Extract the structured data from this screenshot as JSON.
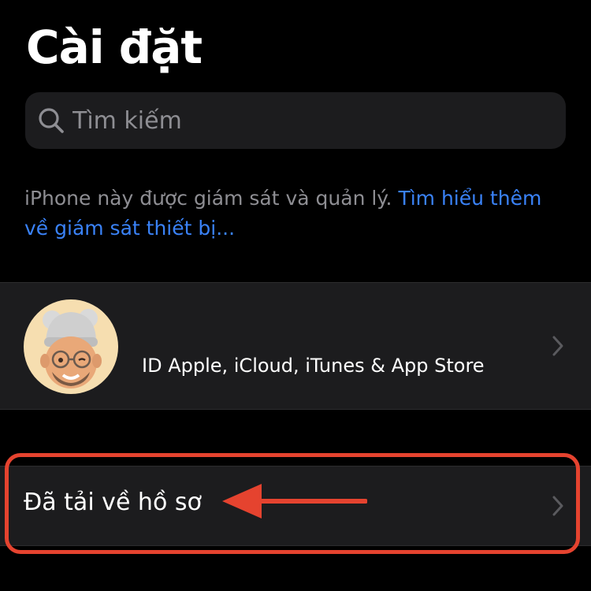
{
  "header": {
    "title": "Cài đặt"
  },
  "search": {
    "placeholder": "Tìm kiếm",
    "icon": "search-icon"
  },
  "supervision": {
    "text": "iPhone này được giám sát và quản lý. ",
    "link": "Tìm hiểu thêm về giám sát thiết bị..."
  },
  "apple_id": {
    "label": "ID Apple, iCloud, iTunes & App Store",
    "avatar": "memoji-avatar"
  },
  "profile": {
    "label": "Đã tải về hồ sơ"
  },
  "annotation": {
    "highlight_color": "#e5432f",
    "arrow_color": "#e5432f"
  },
  "colors": {
    "background": "#000000",
    "row_background": "#1c1c1e",
    "link": "#3a82f7",
    "secondary_text": "#8e8e93"
  }
}
